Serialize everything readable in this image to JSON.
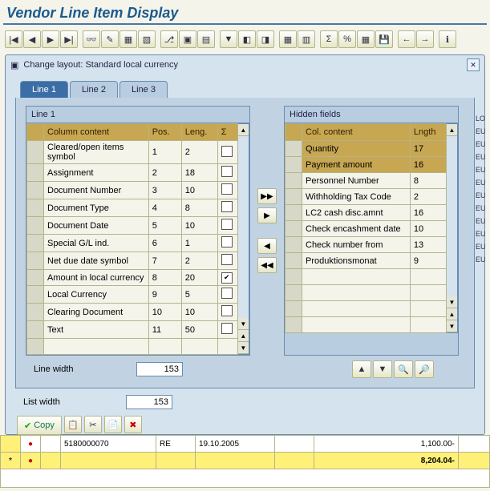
{
  "title": "Vendor Line Item Display",
  "panel": {
    "title": "Change layout: Standard local currency"
  },
  "tabs": [
    {
      "id": "line1",
      "label": "Line 1",
      "active": true
    },
    {
      "id": "line2",
      "label": "Line 2",
      "active": false
    },
    {
      "id": "line3",
      "label": "Line 3",
      "active": false
    }
  ],
  "left_box": {
    "title": "Line 1",
    "headers": {
      "col": "Column content",
      "pos": "Pos.",
      "len": "Leng."
    },
    "rows": [
      {
        "col": "Cleared/open items symbol",
        "pos": "1",
        "len": "2",
        "sum": false
      },
      {
        "col": "Assignment",
        "pos": "2",
        "len": "18",
        "sum": false
      },
      {
        "col": "Document Number",
        "pos": "3",
        "len": "10",
        "sum": false
      },
      {
        "col": "Document Type",
        "pos": "4",
        "len": "8",
        "sum": false
      },
      {
        "col": "Document Date",
        "pos": "5",
        "len": "10",
        "sum": false
      },
      {
        "col": "Special G/L ind.",
        "pos": "6",
        "len": "1",
        "sum": false
      },
      {
        "col": "Net due date symbol",
        "pos": "7",
        "len": "2",
        "sum": false
      },
      {
        "col": "Amount in local currency",
        "pos": "8",
        "len": "20",
        "sum": true
      },
      {
        "col": "Local Currency",
        "pos": "9",
        "len": "5",
        "sum": false
      },
      {
        "col": "Clearing Document",
        "pos": "10",
        "len": "10",
        "sum": false
      },
      {
        "col": "Text",
        "pos": "11",
        "len": "50",
        "sum": false
      }
    ]
  },
  "right_box": {
    "title": "Hidden fields",
    "headers": {
      "col": "Col. content",
      "len": "Lngth"
    },
    "rows": [
      {
        "col": "Quantity",
        "len": "17",
        "sel": true
      },
      {
        "col": "Payment amount",
        "len": "16",
        "sel": true
      },
      {
        "col": "Personnel Number",
        "len": "8",
        "sel": false
      },
      {
        "col": "Withholding Tax Code",
        "len": "2",
        "sel": false
      },
      {
        "col": "LC2 cash disc.amnt",
        "len": "16",
        "sel": false
      },
      {
        "col": "Check encashment date",
        "len": "10",
        "sel": false
      },
      {
        "col": "Check number from",
        "len": "13",
        "sel": false
      },
      {
        "col": "Produktionsmonat",
        "len": "9",
        "sel": false
      }
    ]
  },
  "line_width_label": "Line width",
  "line_width_value": "153",
  "list_width_label": "List width",
  "list_width_value": "153",
  "copy_label": "Copy",
  "total_amount": "8,204.04-",
  "bg_row": {
    "doc": "5180000070",
    "type": "RE",
    "date": "19.10.2005",
    "amt": "1,100.00-"
  },
  "side_letters": [
    "LO",
    "EU",
    "EU",
    "EU",
    "EU",
    "EU",
    "EU",
    "EU",
    "EU",
    "EU",
    "EU",
    "EU"
  ]
}
